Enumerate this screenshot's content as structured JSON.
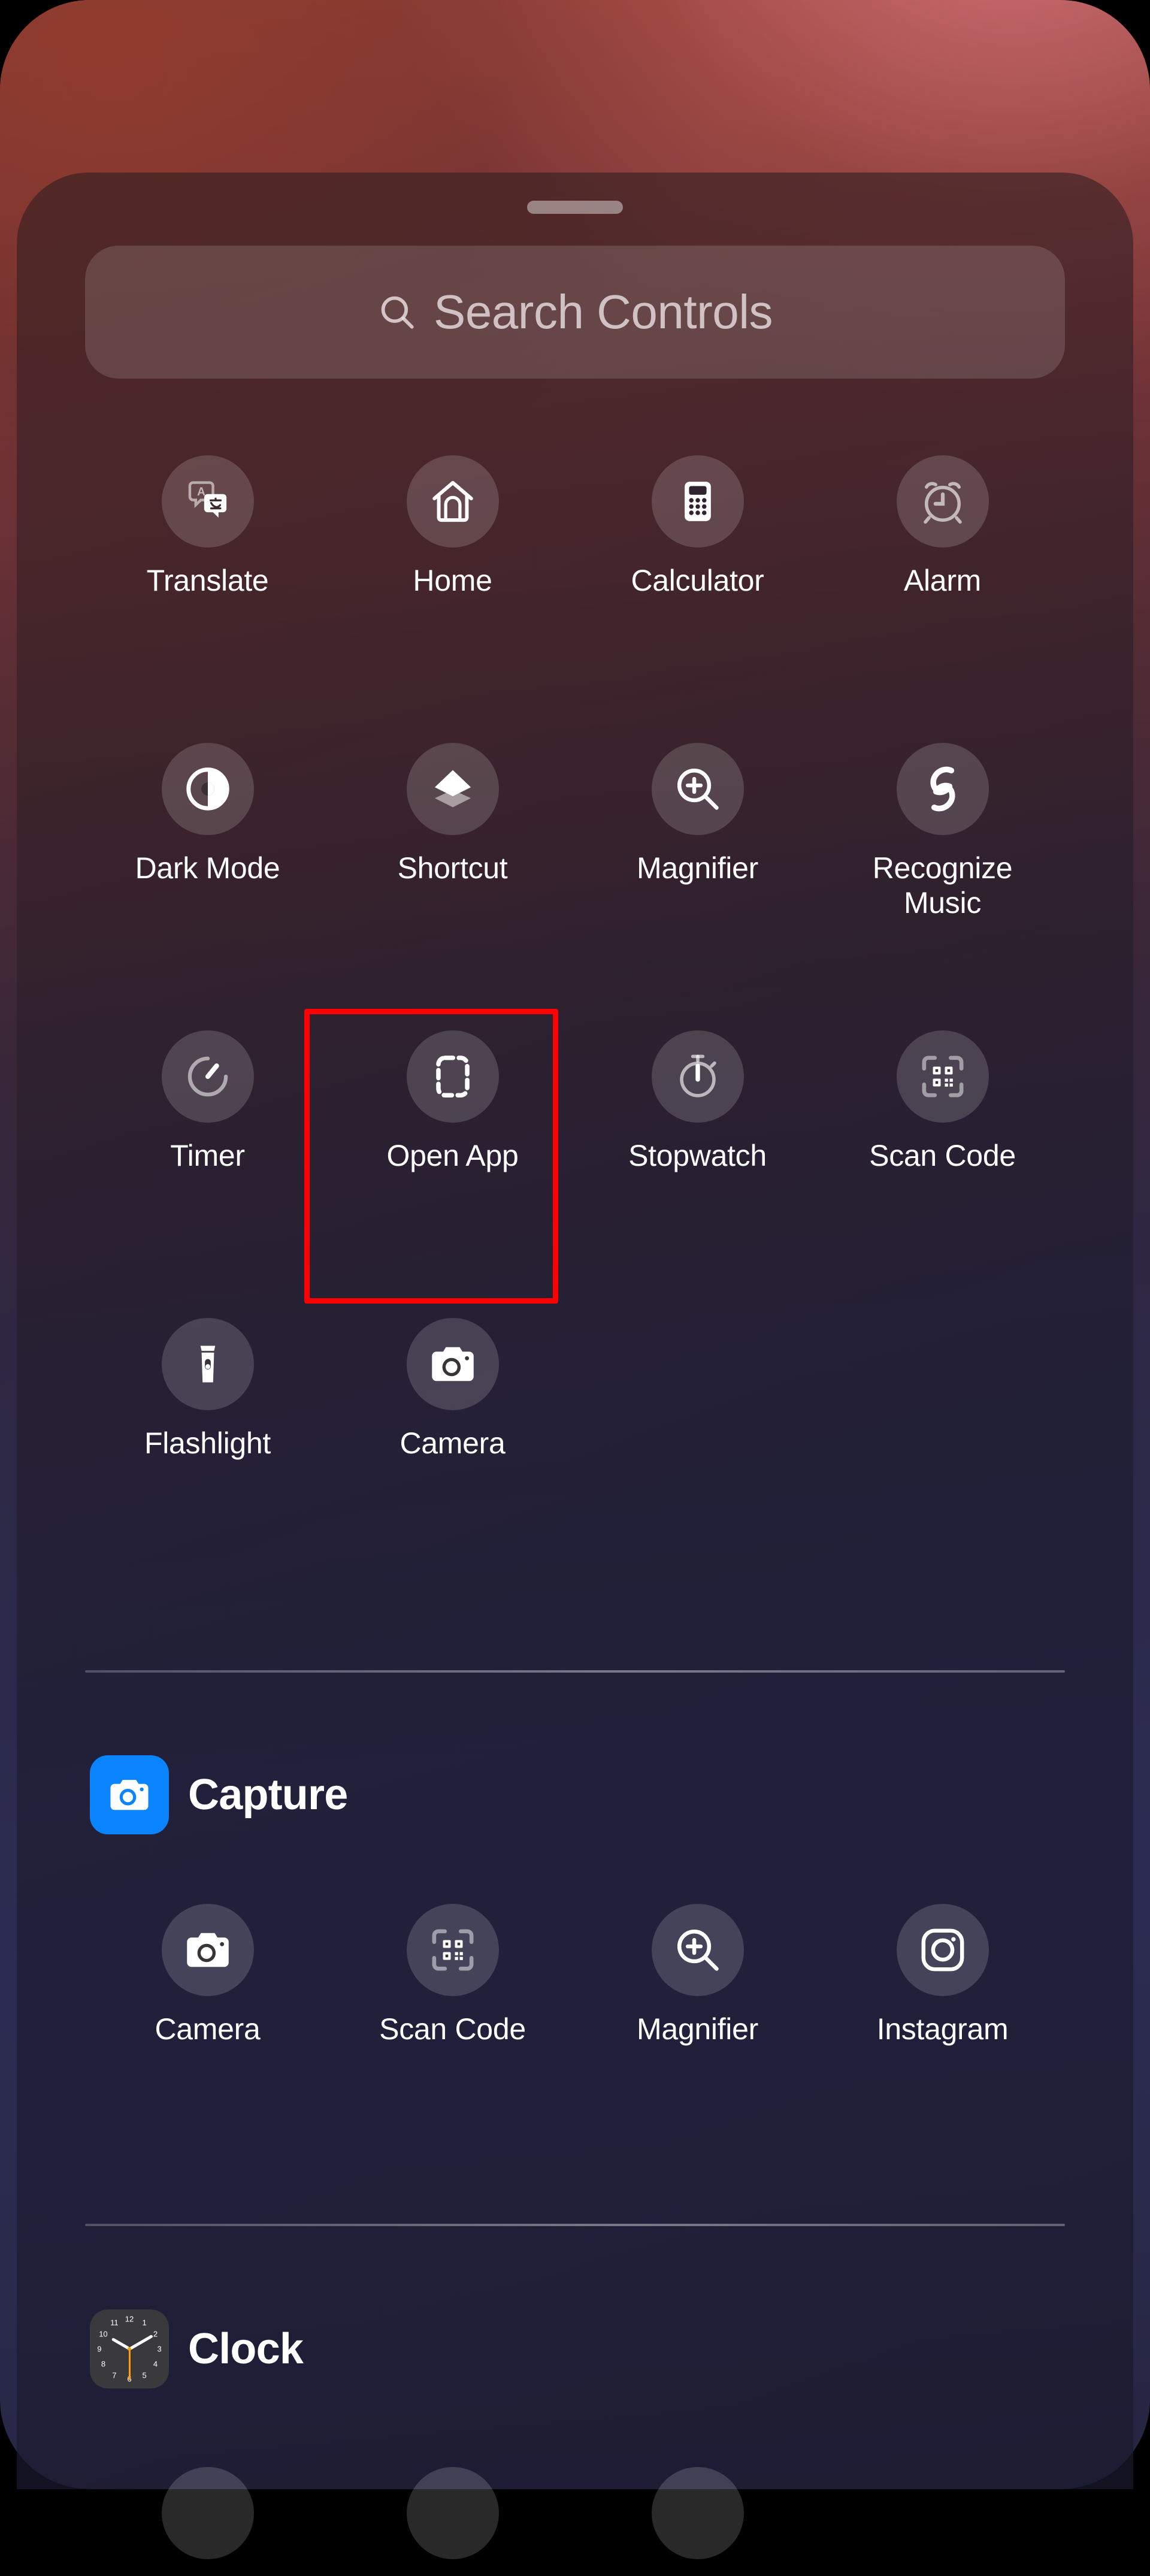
{
  "screen": {
    "device": "iPhone",
    "surface_name": "Control Center",
    "wallpaper_top_color": "#a2473c",
    "wallpaper_bottom_color": "#262541"
  },
  "panel": {
    "drag_handle_name": "grabber"
  },
  "search": {
    "placeholder": "Search Controls",
    "value": "",
    "icon": "search-icon"
  },
  "main_controls": {
    "rows": 4,
    "columns": 4,
    "items": [
      {
        "label": "Translate",
        "icon": "translate-icon",
        "bubble_opacity": 0.16
      },
      {
        "label": "Home",
        "icon": "home-icon",
        "bubble_opacity": 0.16
      },
      {
        "label": "Calculator",
        "icon": "calculator-icon",
        "bubble_opacity": 0.16
      },
      {
        "label": "Alarm",
        "icon": "alarm-clock-icon",
        "bubble_opacity": 0.16
      },
      {
        "label": "Dark Mode",
        "icon": "dark-mode-icon",
        "bubble_opacity": 0.16
      },
      {
        "label": "Shortcut",
        "icon": "shortcut-layers-icon",
        "bubble_opacity": 0.16
      },
      {
        "label": "Magnifier",
        "icon": "magnifier-icon",
        "bubble_opacity": 0.16
      },
      {
        "label": "Recognize Music",
        "icon": "shazam-icon",
        "bubble_opacity": 0.16
      },
      {
        "label": "Timer",
        "icon": "timer-icon",
        "bubble_opacity": 0.16
      },
      {
        "label": "Open App",
        "icon": "open-app-icon",
        "bubble_opacity": 0.16,
        "highlighted": true,
        "highlight_color": "#ff0000"
      },
      {
        "label": "Stopwatch",
        "icon": "stopwatch-icon",
        "bubble_opacity": 0.16
      },
      {
        "label": "Scan Code",
        "icon": "scan-code-icon",
        "bubble_opacity": 0.16
      },
      {
        "label": "Flashlight",
        "icon": "flashlight-icon",
        "bubble_opacity": 0.16
      },
      {
        "label": "Camera",
        "icon": "camera-icon",
        "bubble_opacity": 0.16
      }
    ]
  },
  "sections": [
    {
      "title": "Capture",
      "app_icon": "camera-app-icon",
      "app_icon_color": "#0a84ff",
      "items": [
        {
          "label": "Camera",
          "icon": "camera-icon"
        },
        {
          "label": "Scan Code",
          "icon": "scan-code-icon"
        },
        {
          "label": "Magnifier",
          "icon": "magnifier-icon"
        },
        {
          "label": "Instagram",
          "icon": "instagram-icon"
        }
      ]
    },
    {
      "title": "Clock",
      "app_icon": "clock-app-icon",
      "app_icon_color": "#1c1c1e",
      "clock_numerals": [
        "12",
        "1",
        "2",
        "3",
        "4",
        "5",
        "6",
        "7",
        "8",
        "9",
        "10",
        "11"
      ],
      "items": [
        {
          "label": "",
          "icon": "control-bubble"
        },
        {
          "label": "",
          "icon": "control-bubble"
        },
        {
          "label": "",
          "icon": "control-bubble"
        }
      ]
    }
  ]
}
